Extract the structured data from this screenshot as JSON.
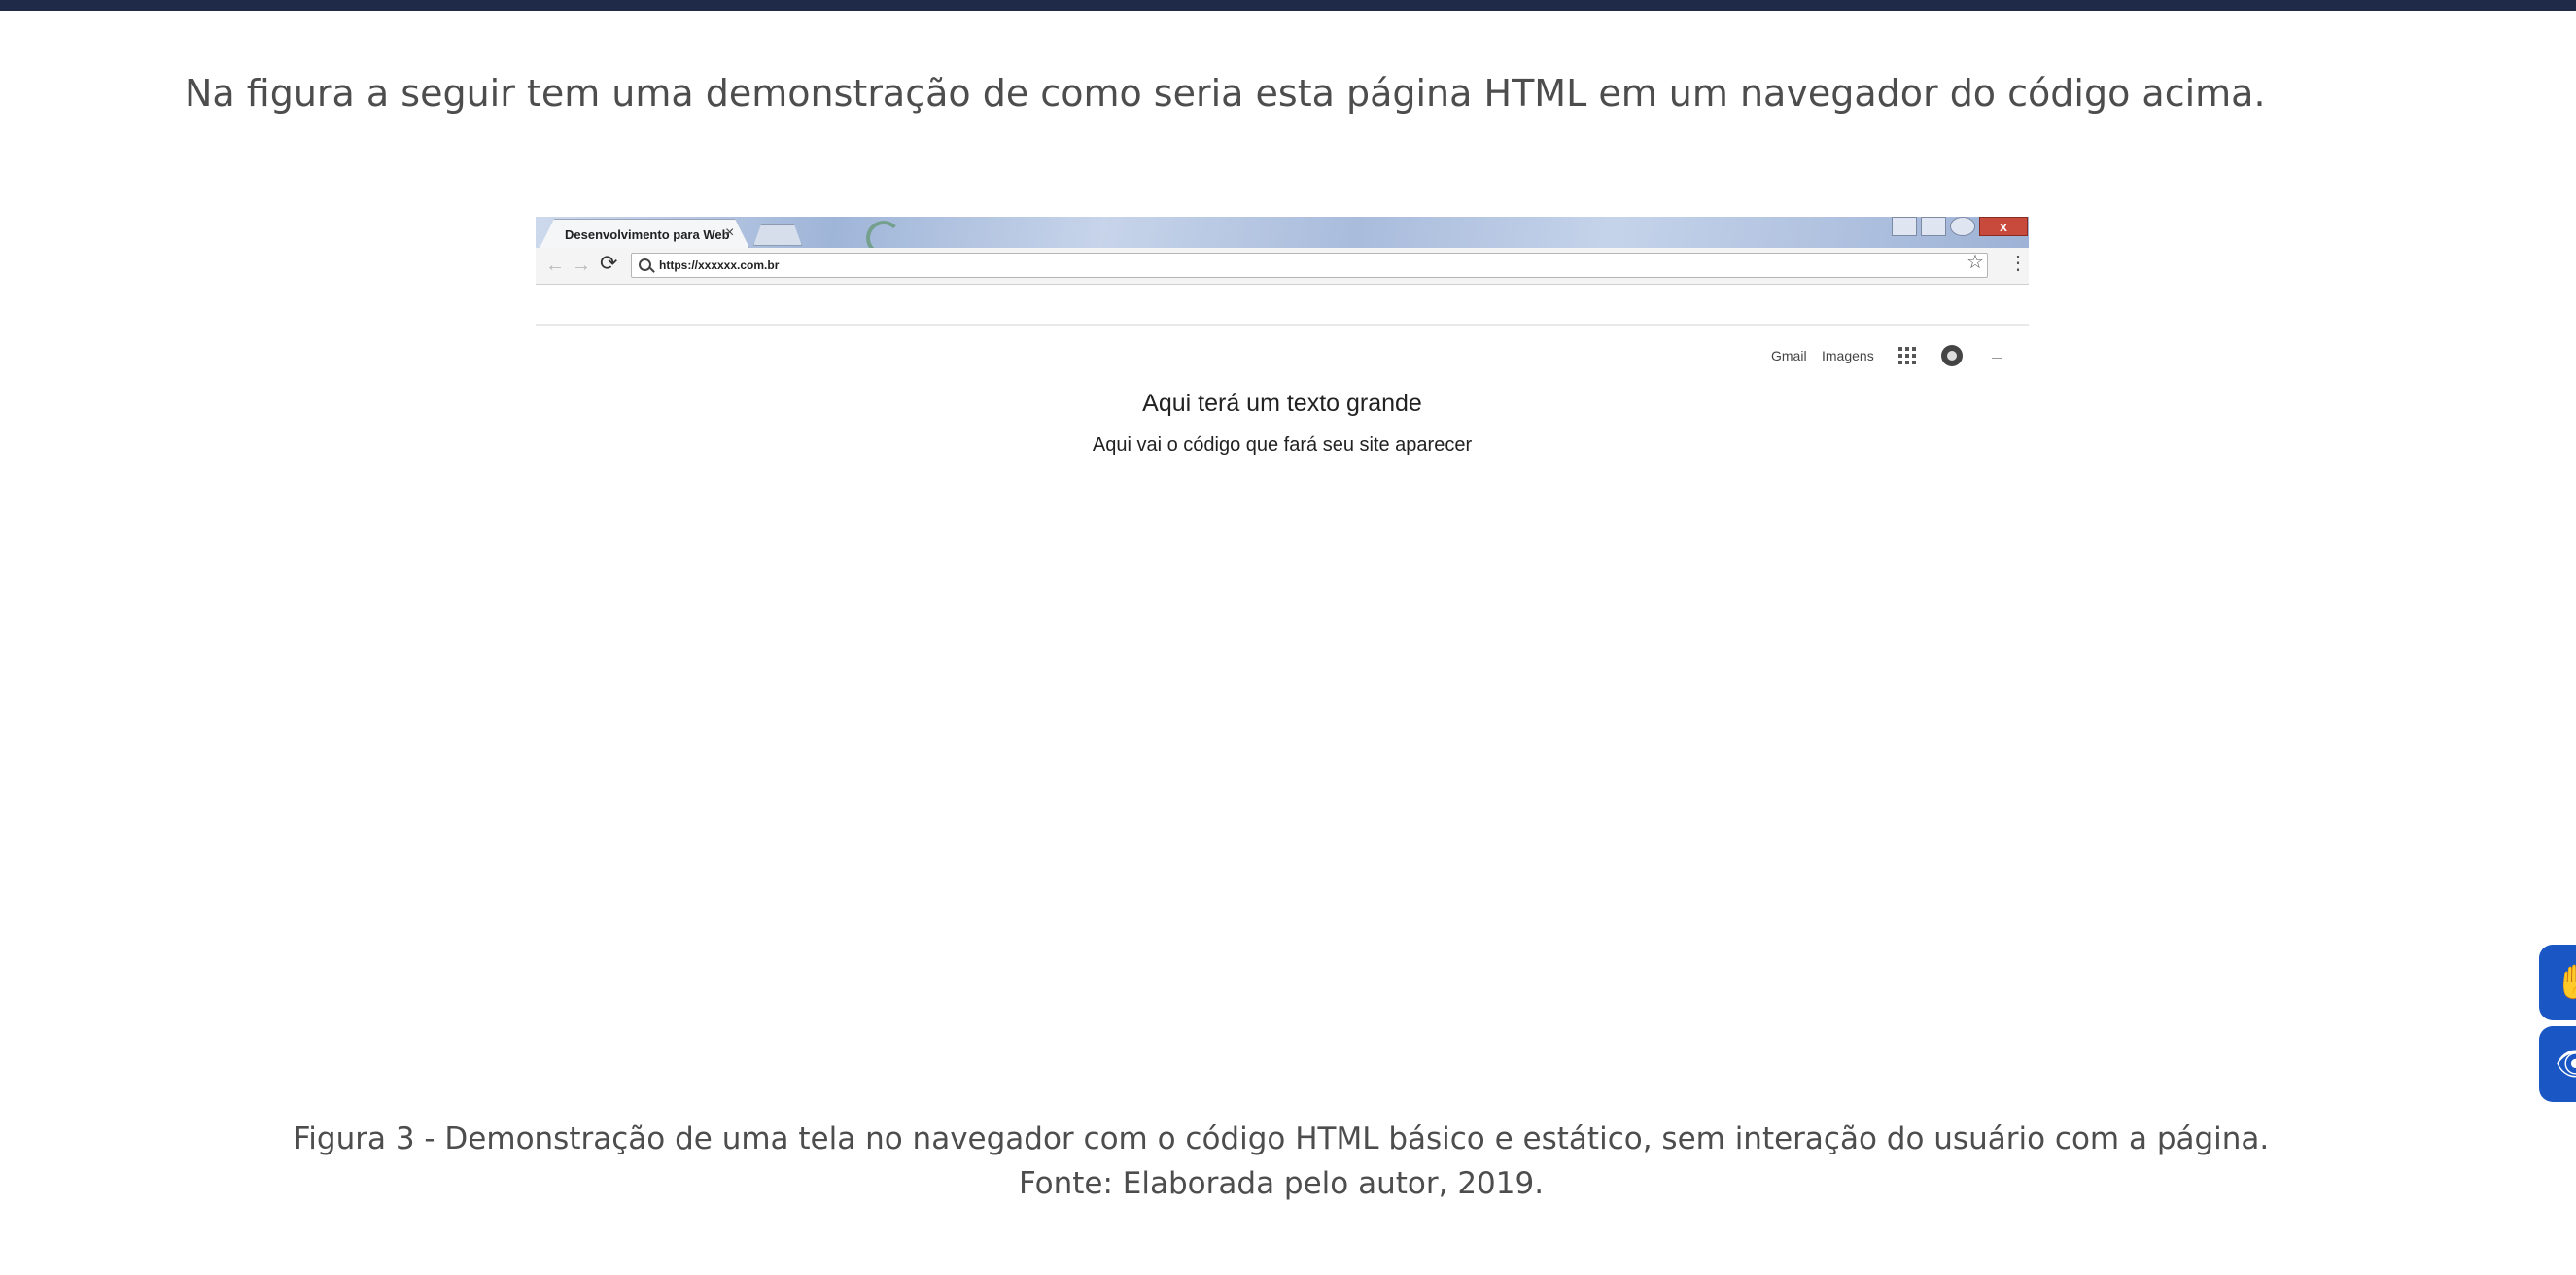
{
  "intro_text": "Na figura a seguir tem uma demonstração de como seria esta página HTML em um navegador do código acima.",
  "browser": {
    "tab_title": "Desenvolvimento para Web",
    "tab_close": "×",
    "window_close": "x",
    "back": "←",
    "forward": "→",
    "reload": "⟳",
    "url": "https://xxxxxx.com.br",
    "star": "☆",
    "menu": "⋮",
    "links": {
      "gmail": "Gmail",
      "imagens": "Imagens"
    },
    "icons": [
      "search-icon",
      "star-icon",
      "apps-grid-icon",
      "account-icon"
    ]
  },
  "page": {
    "heading": "Aqui terá um texto grande",
    "paragraph": "Aqui vai o código que fará seu site aparecer"
  },
  "caption": {
    "line1": "Figura 3 - Demonstração de uma tela no navegador com o código HTML básico e estático, sem interação do usuário com a página.",
    "line2": "Fonte: Elaborada pelo autor, 2019."
  },
  "accessibility": {
    "hand_icon": "✋",
    "eye_icon": "👁"
  },
  "colors": {
    "top_bar": "#1e2a47",
    "text": "#4d4d4d",
    "accessibility_blue": "#1a57c4"
  }
}
